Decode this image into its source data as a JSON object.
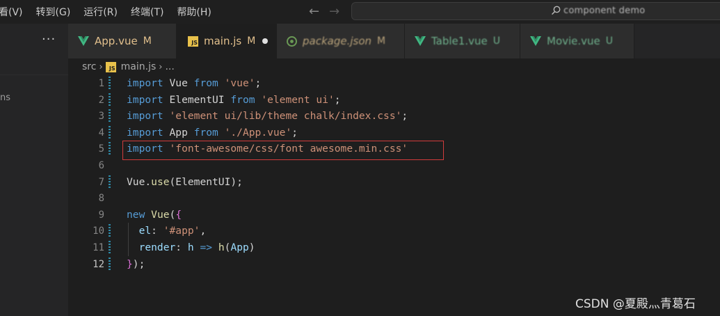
{
  "menu": {
    "items": [
      "看(V)",
      "转到(G)",
      "运行(R)",
      "终端(T)",
      "帮助(H)"
    ]
  },
  "command_center": {
    "text": "component demo"
  },
  "sidebar": {
    "more": "···",
    "label": "ns"
  },
  "tabs": [
    {
      "label": "App.vue",
      "status": "M",
      "icon": "vue-icon",
      "active": false
    },
    {
      "label": "main.js",
      "status": "M",
      "icon": "js-icon",
      "active": true
    },
    {
      "label": "package.json",
      "status": "M",
      "icon": "json-icon",
      "active": false
    },
    {
      "label": "Table1.vue",
      "status": "U",
      "icon": "vue-icon",
      "active": false
    },
    {
      "label": "Movie.vue",
      "status": "U",
      "icon": "vue-icon",
      "active": false
    }
  ],
  "breadcrumb": {
    "folder": "src",
    "file": "main.js",
    "tail": "...",
    "badge": "JS"
  },
  "editor": {
    "current_line": 12,
    "lines": [
      {
        "n": "1",
        "tokens": [
          [
            "kw",
            "import"
          ],
          [
            "id",
            " Vue "
          ],
          [
            "kw",
            "from"
          ],
          [
            "id",
            " "
          ],
          [
            "str",
            "'vue'"
          ],
          [
            "pun",
            ";"
          ]
        ]
      },
      {
        "n": "2",
        "tokens": [
          [
            "kw",
            "import"
          ],
          [
            "id",
            " ElementUI "
          ],
          [
            "kw",
            "from"
          ],
          [
            "id",
            " "
          ],
          [
            "str",
            "'element ui'"
          ],
          [
            "pun",
            ";"
          ]
        ]
      },
      {
        "n": "3",
        "tokens": [
          [
            "kw",
            "import"
          ],
          [
            "id",
            " "
          ],
          [
            "str",
            "'element ui/lib/theme chalk/index.css'"
          ],
          [
            "pun",
            ";"
          ]
        ]
      },
      {
        "n": "4",
        "tokens": [
          [
            "kw",
            "import"
          ],
          [
            "id",
            " App "
          ],
          [
            "kw",
            "from"
          ],
          [
            "id",
            " "
          ],
          [
            "str",
            "'./App.vue'"
          ],
          [
            "pun",
            ";"
          ]
        ]
      },
      {
        "n": "5",
        "tokens": [
          [
            "kw",
            "import"
          ],
          [
            "id",
            " "
          ],
          [
            "str",
            "'font-awesome/css/font awesome.min.css'"
          ]
        ]
      },
      {
        "n": "6",
        "tokens": []
      },
      {
        "n": "7",
        "tokens": [
          [
            "id",
            "Vue."
          ],
          [
            "fn",
            "use"
          ],
          [
            "pun",
            "(ElementUI);"
          ]
        ]
      },
      {
        "n": "8",
        "tokens": []
      },
      {
        "n": "9",
        "tokens": [
          [
            "kw",
            "new"
          ],
          [
            "id",
            " "
          ],
          [
            "fn",
            "Vue"
          ],
          [
            "pun",
            "("
          ],
          [
            "brk",
            "{"
          ]
        ]
      },
      {
        "n": "10",
        "tokens": [
          [
            "id",
            "  "
          ],
          [
            "prop",
            "el"
          ],
          [
            "pun",
            ": "
          ],
          [
            "str",
            "'#app'"
          ],
          [
            "pun",
            ","
          ]
        ]
      },
      {
        "n": "11",
        "tokens": [
          [
            "id",
            "  "
          ],
          [
            "prop",
            "render"
          ],
          [
            "pun",
            ": "
          ],
          [
            "prop",
            "h"
          ],
          [
            "id",
            " "
          ],
          [
            "kw",
            "=>"
          ],
          [
            "id",
            " "
          ],
          [
            "fn",
            "h"
          ],
          [
            "pun",
            "("
          ],
          [
            "prop",
            "App"
          ],
          [
            "pun",
            ")"
          ]
        ]
      },
      {
        "n": "12",
        "tokens": [
          [
            "brk",
            "}"
          ],
          [
            "pun",
            ");"
          ]
        ]
      }
    ]
  },
  "watermark": "CSDN @夏殿灬青葛石",
  "colors": {
    "vue": "#41b883",
    "js": "#e8c14b",
    "highlight": "#d23c3c"
  }
}
